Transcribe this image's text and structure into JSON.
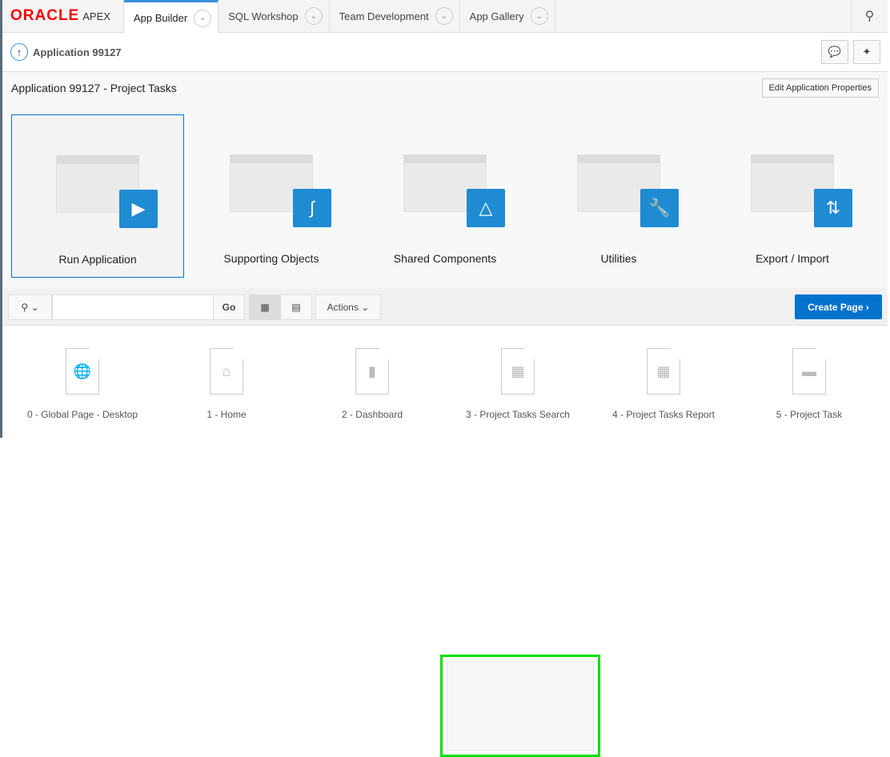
{
  "header": {
    "logo": "ORACLE",
    "product": "APEX",
    "tabs": [
      {
        "label": "App Builder"
      },
      {
        "label": "SQL Workshop"
      },
      {
        "label": "Team Development"
      },
      {
        "label": "App Gallery"
      }
    ]
  },
  "breadcrumb": {
    "label": "Application 99127"
  },
  "region": {
    "title": "Application 99127 - Project Tasks",
    "edit_label": "Edit Application Properties"
  },
  "tiles": [
    {
      "label": "Run Application",
      "icon": "play-icon"
    },
    {
      "label": "Supporting Objects",
      "icon": "scroll-icon"
    },
    {
      "label": "Shared Components",
      "icon": "shapes-icon"
    },
    {
      "label": "Utilities",
      "icon": "wrench-icon"
    },
    {
      "label": "Export / Import",
      "icon": "arrows-icon"
    }
  ],
  "toolbar": {
    "search_value": "",
    "go_label": "Go",
    "actions_label": "Actions",
    "create_label": "Create Page"
  },
  "pages": [
    {
      "label": "0 - Global Page - Desktop"
    },
    {
      "label": "1 - Home"
    },
    {
      "label": "2 - Dashboard"
    },
    {
      "label": "3 - Project Tasks Search"
    },
    {
      "label": "4 - Project Tasks Report"
    },
    {
      "label": "5 - Project Task"
    }
  ],
  "colors": {
    "accent": "#0572ce",
    "highlight": "#00e000",
    "badge": "#1e8bd3"
  }
}
